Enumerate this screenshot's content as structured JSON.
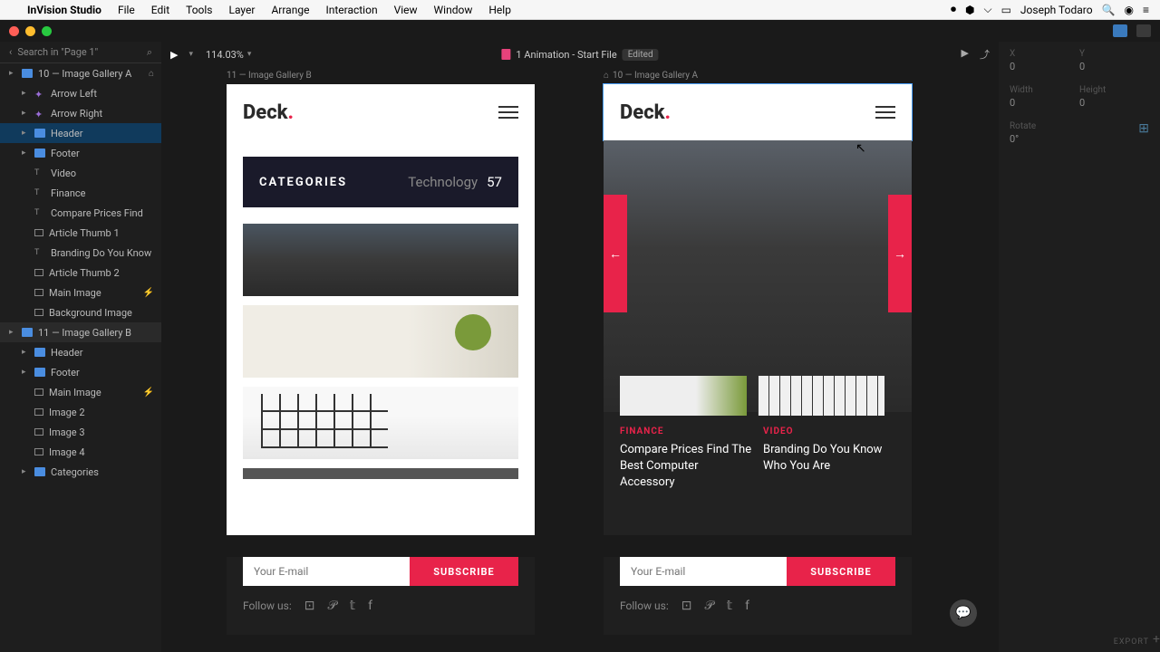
{
  "menubar": {
    "app": "InVision Studio",
    "items": [
      "File",
      "Edit",
      "Tools",
      "Layer",
      "Arrange",
      "Interaction",
      "View",
      "Window",
      "Help"
    ],
    "user": "Joseph Todaro"
  },
  "search": {
    "placeholder": "Search in \"Page 1\""
  },
  "layers": [
    {
      "lvl": 1,
      "type": "artboard",
      "label": "10 — Image Gallery A",
      "expand": true,
      "home": true
    },
    {
      "lvl": 2,
      "type": "comp",
      "label": "Arrow Left"
    },
    {
      "lvl": 2,
      "type": "comp",
      "label": "Arrow Right"
    },
    {
      "lvl": 2,
      "type": "folder",
      "label": "Header",
      "active": true
    },
    {
      "lvl": 2,
      "type": "folder",
      "label": "Footer"
    },
    {
      "lvl": 2,
      "type": "text",
      "label": "Video"
    },
    {
      "lvl": 2,
      "type": "text",
      "label": "Finance"
    },
    {
      "lvl": 2,
      "type": "text",
      "label": "Compare Prices Find"
    },
    {
      "lvl": 2,
      "type": "img",
      "label": "Article Thumb 1"
    },
    {
      "lvl": 2,
      "type": "text",
      "label": "Branding Do You Know"
    },
    {
      "lvl": 2,
      "type": "img",
      "label": "Article Thumb 2"
    },
    {
      "lvl": 2,
      "type": "img",
      "label": "Main Image",
      "bolt": true
    },
    {
      "lvl": 2,
      "type": "img",
      "label": "Background Image"
    },
    {
      "lvl": 1,
      "type": "artboard",
      "label": "11 — Image Gallery B",
      "expand": true,
      "sel": true
    },
    {
      "lvl": 2,
      "type": "folder",
      "label": "Header"
    },
    {
      "lvl": 2,
      "type": "folder",
      "label": "Footer"
    },
    {
      "lvl": 2,
      "type": "img",
      "label": "Main Image",
      "bolt": true
    },
    {
      "lvl": 2,
      "type": "img",
      "label": "Image 2"
    },
    {
      "lvl": 2,
      "type": "img",
      "label": "Image 3"
    },
    {
      "lvl": 2,
      "type": "img",
      "label": "Image 4"
    },
    {
      "lvl": 2,
      "type": "folder",
      "label": "Categories"
    }
  ],
  "topbar": {
    "zoom": "114.03%",
    "doc": "1 Animation - Start File",
    "badge": "Edited"
  },
  "artboards": {
    "a": {
      "label": "11 — Image Gallery B"
    },
    "b": {
      "label": "10 — Image Gallery A",
      "home": true
    }
  },
  "deck": {
    "brand": "Deck"
  },
  "categories": {
    "label": "CATEGORIES",
    "topic": "Technology",
    "count": "57"
  },
  "articles": [
    {
      "cat": "FINANCE",
      "headline": "Compare Prices Find The Best Computer Accessory"
    },
    {
      "cat": "VIDEO",
      "headline": "Branding Do You Know Who You Are"
    }
  ],
  "subscribe": {
    "placeholder": "Your E-mail",
    "btn": "SUBSCRIBE"
  },
  "follow": {
    "label": "Follow us:"
  },
  "inspector": {
    "x": {
      "lbl": "X",
      "val": "0"
    },
    "y": {
      "lbl": "Y",
      "val": "0"
    },
    "w": {
      "lbl": "Width",
      "val": "0"
    },
    "h": {
      "lbl": "Height",
      "val": "0"
    },
    "r": {
      "lbl": "Rotate",
      "val": "0°"
    }
  },
  "export": "EXPORT"
}
